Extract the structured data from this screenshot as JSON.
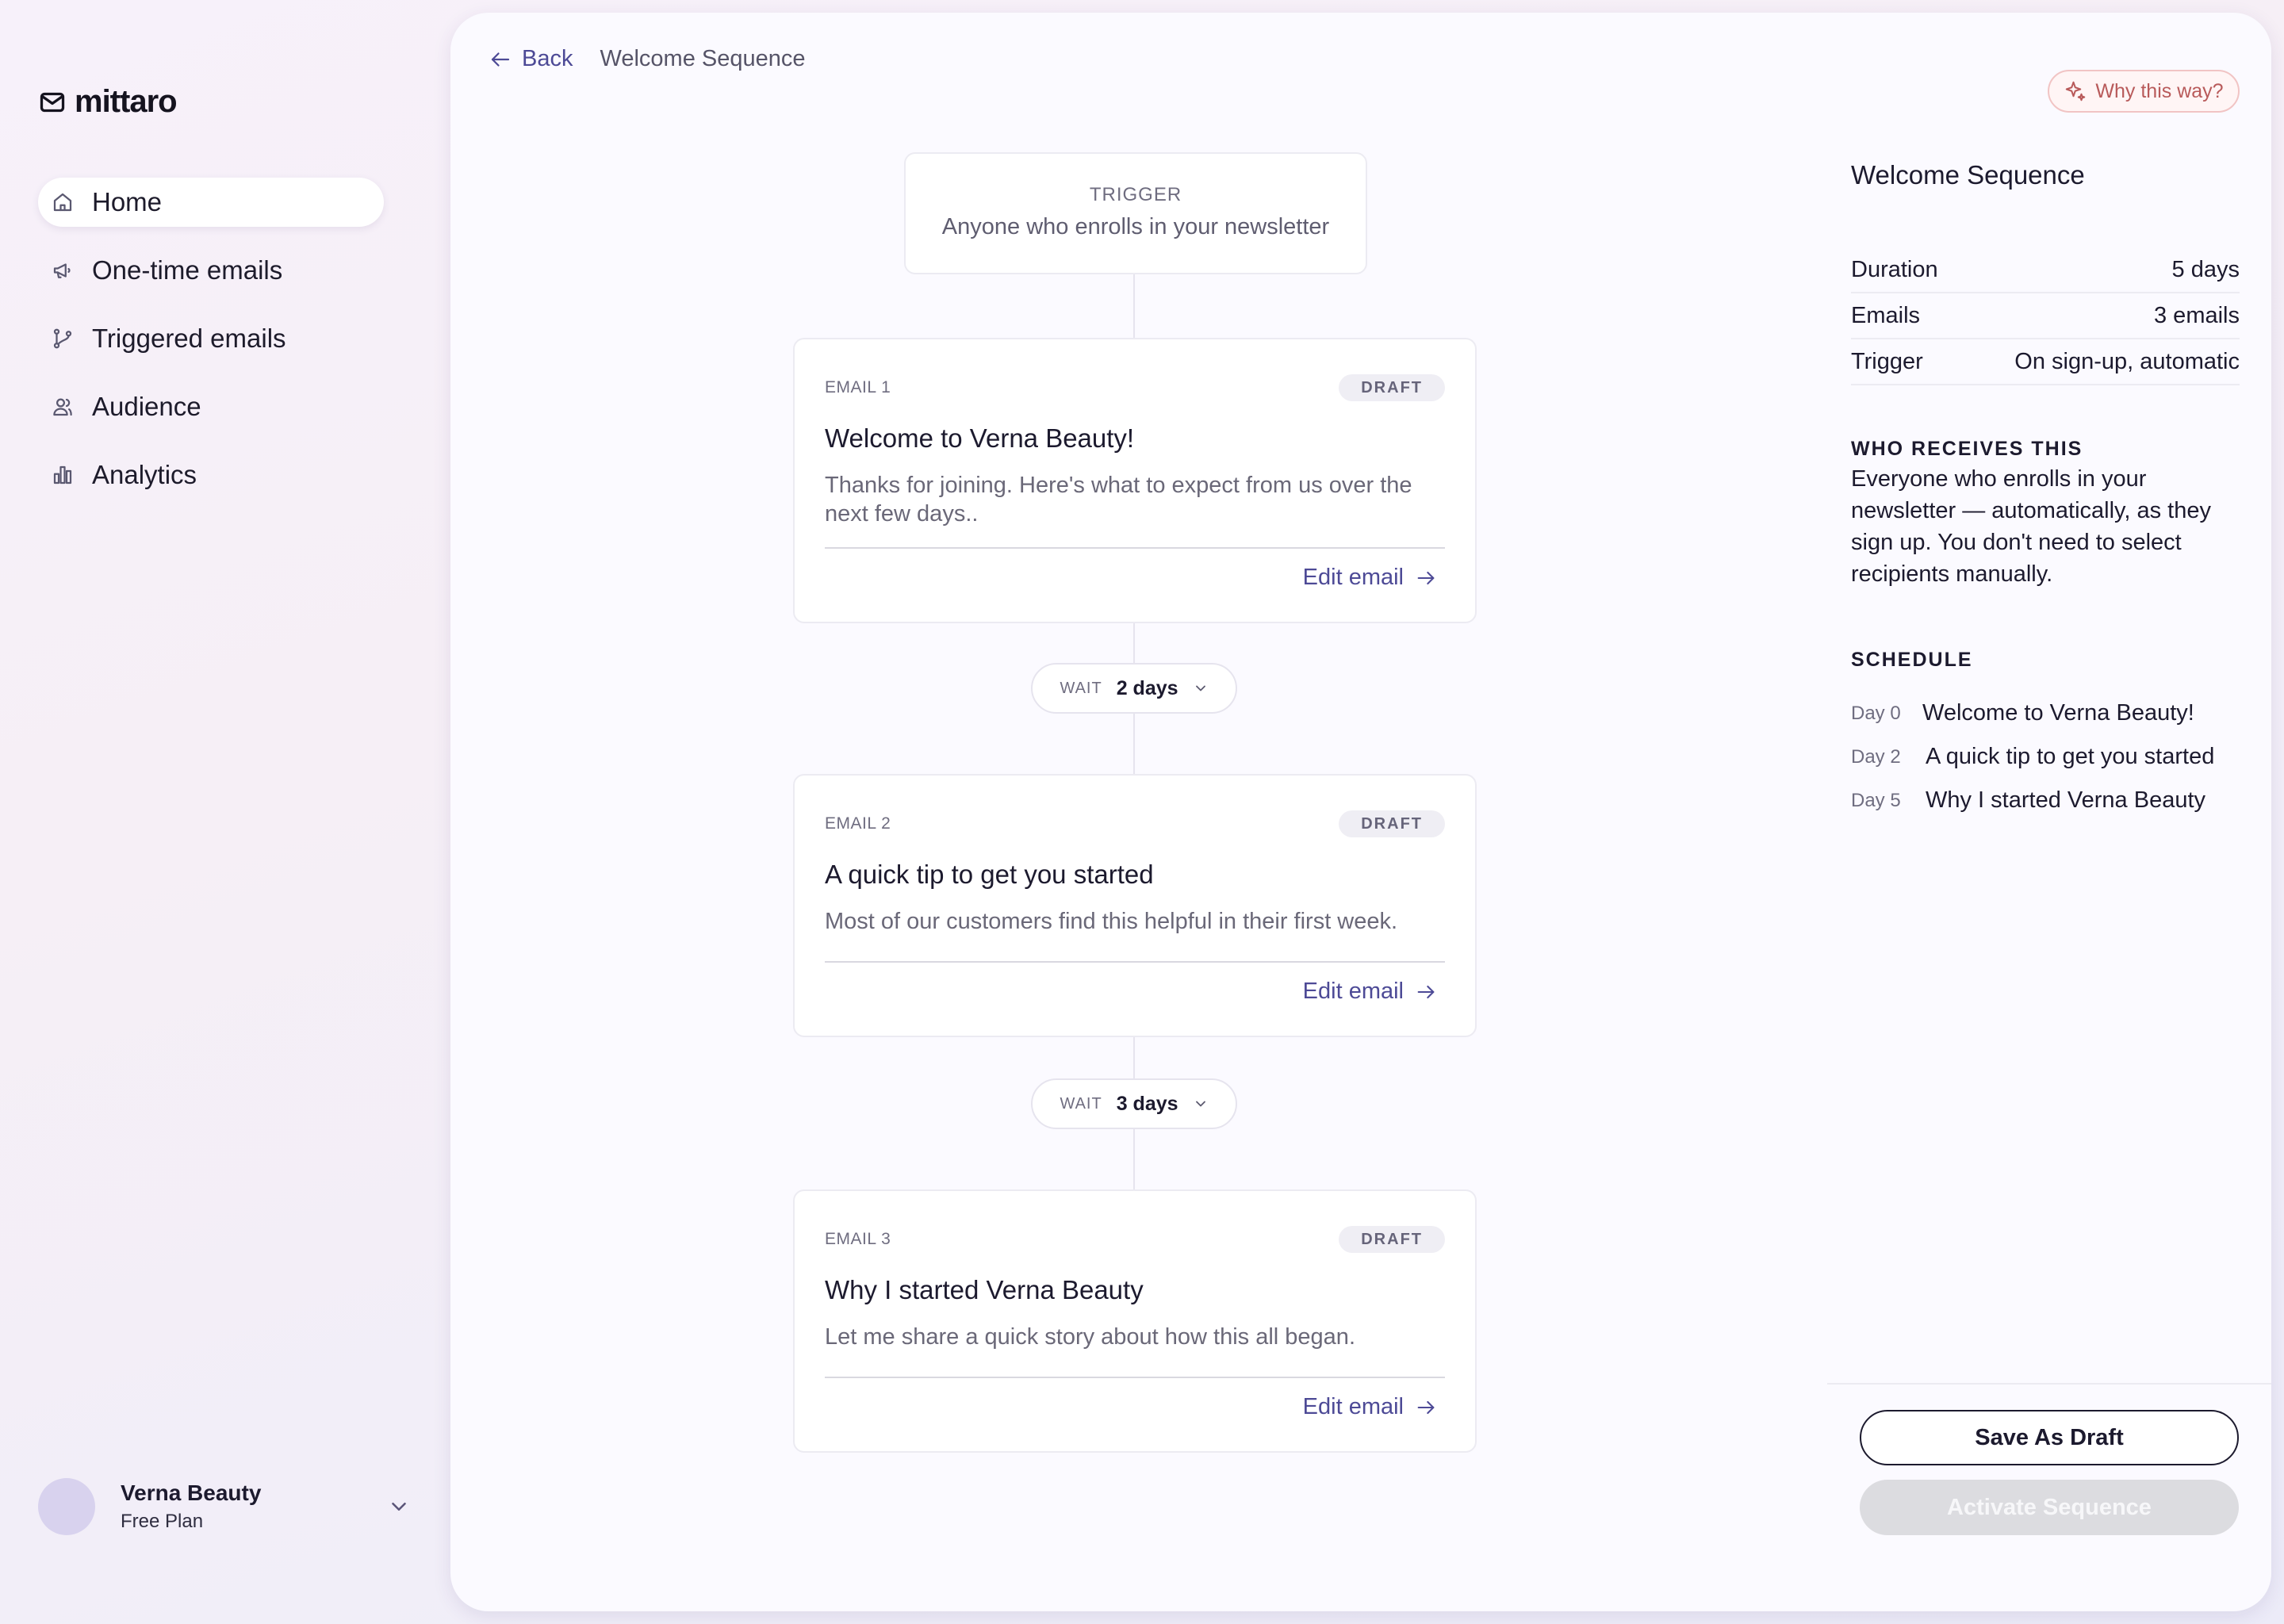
{
  "brand": {
    "name": "mittaro"
  },
  "nav": {
    "items": [
      {
        "label": "Home",
        "icon": "home-icon",
        "active": true
      },
      {
        "label": "One-time emails",
        "icon": "megaphone-icon",
        "active": false
      },
      {
        "label": "Triggered emails",
        "icon": "branch-icon",
        "active": false
      },
      {
        "label": "Audience",
        "icon": "users-icon",
        "active": false
      },
      {
        "label": "Analytics",
        "icon": "bar-chart-icon",
        "active": false
      }
    ]
  },
  "account": {
    "name": "Verna Beauty",
    "plan": "Free Plan"
  },
  "topbar": {
    "back_label": "Back",
    "breadcrumb": "Welcome Sequence"
  },
  "why_button": {
    "label": "Why this way?"
  },
  "flow": {
    "trigger": {
      "label": "TRIGGER",
      "description": "Anyone who enrolls in your newsletter"
    },
    "emails": [
      {
        "label": "EMAIL 1",
        "status": "DRAFT",
        "title": "Welcome to Verna Beauty!",
        "description": "Thanks for joining. Here's what to expect from us over the next few days..",
        "edit_label": "Edit email"
      },
      {
        "label": "EMAIL 2",
        "status": "DRAFT",
        "title": "A quick tip to get you started",
        "description": "Most of our customers find this helpful in their first week.",
        "edit_label": "Edit email"
      },
      {
        "label": "EMAIL 3",
        "status": "DRAFT",
        "title": "Why I started Verna Beauty",
        "description": "Let me share a quick story about how this all began.",
        "edit_label": "Edit email"
      }
    ],
    "waits": [
      {
        "label": "WAIT",
        "value": "2 days"
      },
      {
        "label": "WAIT",
        "value": "3 days"
      }
    ]
  },
  "panel": {
    "title": "Welcome Sequence",
    "meta": [
      {
        "key": "Duration",
        "value": "5 days"
      },
      {
        "key": "Emails",
        "value": "3 emails"
      },
      {
        "key": "Trigger",
        "value": "On sign-up, automatic"
      }
    ],
    "receives_heading": "WHO RECEIVES THIS",
    "receives_text": "Everyone who enrolls in your newsletter — automatically, as they sign up. You don't need to select recipients manually.",
    "schedule_heading": "SCHEDULE",
    "schedule": [
      {
        "day": "Day 0",
        "title": "Welcome to Verna Beauty!"
      },
      {
        "day": "Day 2",
        "title": "A quick tip to get you started"
      },
      {
        "day": "Day 5",
        "title": "Why I started Verna Beauty"
      }
    ]
  },
  "actions": {
    "save_draft": "Save As Draft",
    "activate": "Activate Sequence",
    "activate_enabled": false
  }
}
